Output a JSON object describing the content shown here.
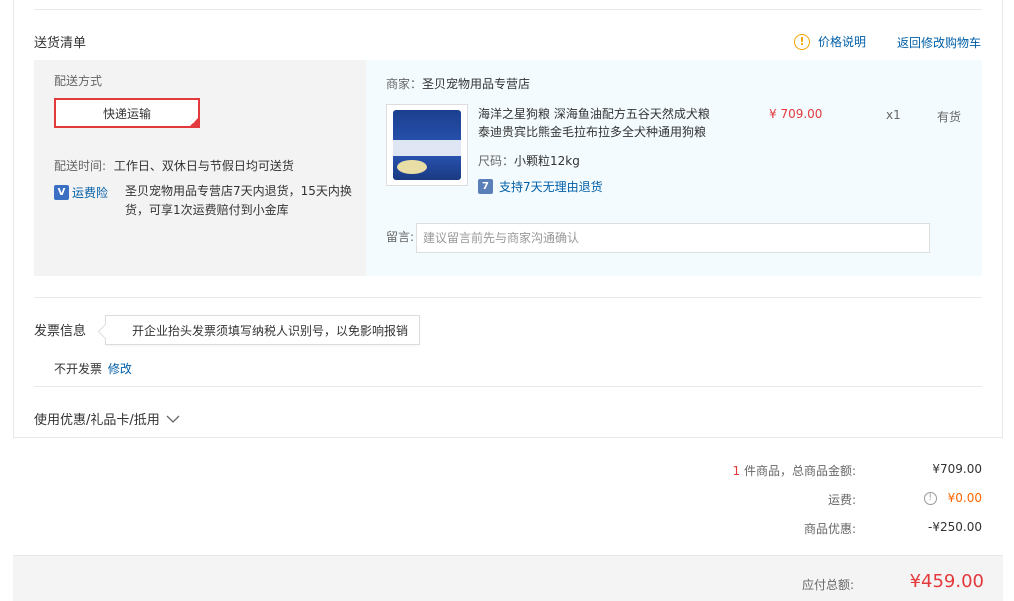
{
  "delivery": {
    "title": "送货清单",
    "price_note": "价格说明",
    "back_to_cart": "返回修改购物车",
    "shipping_method_label": "配送方式",
    "express_label": "快递运输",
    "delivery_time_label": "配送时间:",
    "delivery_time_value": "工作日、双休日与节假日均可送货",
    "insurance_label": "运费险",
    "insurance_desc_line1": "圣贝宠物用品专营店7天内退货，15天内换",
    "insurance_desc_line2": "货，可享1次运费赔付到小金库"
  },
  "goods": {
    "merchant_label": "商家：",
    "merchant_name": "圣贝宠物用品专营店",
    "product_title_line1": "海洋之星狗粮 深海鱼油配方五谷天然成犬粮",
    "product_title_line2": "泰迪贵宾比熊金毛拉布拉多全犬种通用狗粮",
    "price": "¥ 709.00",
    "quantity": "x1",
    "stock": "有货",
    "size_label": "尺码：",
    "size_value": "小颗粒12kg",
    "return_policy": "支持7天无理由退货",
    "note_label": "留言:",
    "note_placeholder": "建议留言前先与商家沟通确认"
  },
  "invoice": {
    "title": "发票信息",
    "tip": "开企业抬头发票须填写纳税人识别号，以免影响报销",
    "status": "不开发票",
    "edit": "修改"
  },
  "coupon": {
    "label": "使用优惠/礼品卡/抵用"
  },
  "summary": {
    "item_count": "1",
    "item_count_suffix": "件商品，总商品金额:",
    "goods_total": "¥709.00",
    "freight_label": "运费:",
    "freight_value": "¥0.00",
    "discount_label": "商品优惠:",
    "discount_value": "-¥250.00",
    "payable_label": "应付总额:",
    "payable_value": "¥459.00"
  },
  "colors": {
    "accent_red": "#e4393c",
    "link_blue": "#005ea7",
    "freight_orange": "#ff6600",
    "warn_orange": "#f0a400"
  },
  "icons": {
    "price_note": "warning-circle-icon",
    "insurance": "shield-icon",
    "return": "seven-day-return-icon",
    "coupon_toggle": "chevron-down-icon",
    "freight_info": "info-circle-icon"
  }
}
